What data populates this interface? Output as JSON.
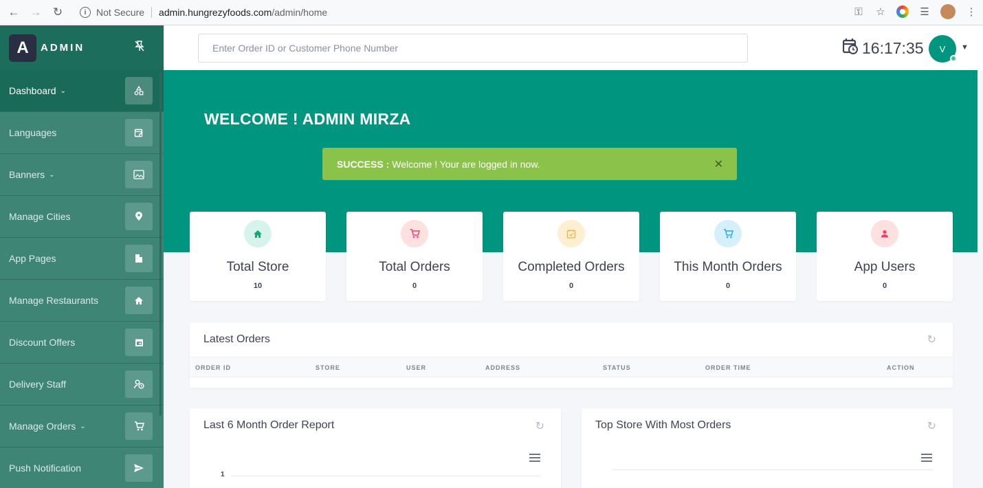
{
  "browser": {
    "security_label": "Not Secure",
    "url_host": "admin.hungrezyfoods.com",
    "url_path": "/admin/home"
  },
  "brand": {
    "logo_letter": "A",
    "name": "ADMIN"
  },
  "sidebar": {
    "items": [
      {
        "label": "Dashboard",
        "icon": "shapes-icon",
        "has_caret": true,
        "active": true
      },
      {
        "label": "Languages",
        "icon": "calendar-edit-icon",
        "has_caret": false
      },
      {
        "label": "Banners",
        "icon": "image-icon",
        "has_caret": true
      },
      {
        "label": "Manage Cities",
        "icon": "location-pin-icon",
        "has_caret": false
      },
      {
        "label": "App Pages",
        "icon": "file-icon",
        "has_caret": false
      },
      {
        "label": "Manage Restaurants",
        "icon": "home-icon",
        "has_caret": false
      },
      {
        "label": "Discount Offers",
        "icon": "calendar-icon",
        "has_caret": false
      },
      {
        "label": "Delivery Staff",
        "icon": "user-clock-icon",
        "has_caret": false
      },
      {
        "label": "Manage Orders",
        "icon": "cart-icon",
        "has_caret": true
      },
      {
        "label": "Push Notification",
        "icon": "send-icon",
        "has_caret": false
      }
    ]
  },
  "topbar": {
    "search_placeholder": "Enter Order ID or Customer Phone Number",
    "clock": "16:17:35",
    "avatar_letter": "V"
  },
  "hero": {
    "welcome": "WELCOME ! ADMIN MIRZA",
    "alert_strong": "SUCCESS :",
    "alert_text": "Welcome ! Your are logged in now.",
    "alert_color": "#8bc34a",
    "bg_color": "#00957f"
  },
  "stats": [
    {
      "title": "Total Store",
      "value": "10",
      "icon": "home-icon",
      "icon_bg": "#d6f3ec",
      "icon_color": "#1ba37f"
    },
    {
      "title": "Total Orders",
      "value": "0",
      "icon": "cart-icon",
      "icon_bg": "#fde0e0",
      "icon_color": "#f1416c"
    },
    {
      "title": "Completed Orders",
      "value": "0",
      "icon": "calendar-check-icon",
      "icon_bg": "#fdf0d2",
      "icon_color": "#f1b441"
    },
    {
      "title": "This Month Orders",
      "value": "0",
      "icon": "cart-icon",
      "icon_bg": "#d6f0fb",
      "icon_color": "#2fa4e7"
    },
    {
      "title": "App Users",
      "value": "0",
      "icon": "user-icon",
      "icon_bg": "#fde0e0",
      "icon_color": "#f1416c"
    }
  ],
  "latest_orders": {
    "title": "Latest Orders",
    "columns": [
      "ORDER ID",
      "STORE",
      "USER",
      "ADDRESS",
      "STATUS",
      "ORDER TIME",
      "ACTION"
    ]
  },
  "report": {
    "title": "Last 6 Month Order Report",
    "axis_tick": "1"
  },
  "top_store": {
    "title": "Top Store With Most Orders"
  }
}
